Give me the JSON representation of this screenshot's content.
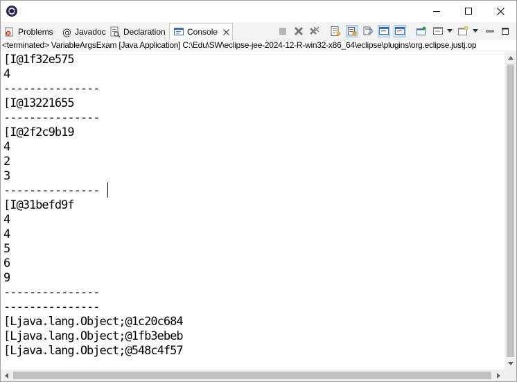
{
  "window": {
    "icon": "eclipse-icon",
    "controls": [
      "minimize-icon",
      "maximize-icon",
      "close-icon"
    ]
  },
  "tabs": [
    {
      "label": "Problems",
      "icon": "problems-icon"
    },
    {
      "label": "Javadoc",
      "icon": "javadoc-at-icon"
    },
    {
      "label": "Declaration",
      "icon": "declaration-icon"
    },
    {
      "label": "Console",
      "icon": "console-icon",
      "active": true
    }
  ],
  "toolbar": {
    "icons": [
      "terminate-icon",
      "remove-launch-icon",
      "remove-all-terminated-icon",
      "clear-console-icon",
      "scroll-lock-icon",
      "word-wrap-icon",
      "show-on-stdout-icon",
      "show-on-stderr-icon",
      "pin-console-icon",
      "display-selected-console-icon",
      "open-console-icon",
      "minimize-view-icon",
      "maximize-view-icon"
    ]
  },
  "status": {
    "text": "<terminated> VariableArgsExam [Java Application] C:\\Edu\\SW\\eclipse-jee-2024-12-R-win32-x86_64\\eclipse\\plugins\\org.eclipse.justj.op"
  },
  "console": {
    "lines": [
      "[I@1f32e575",
      "4",
      "---------------",
      "[I@13221655",
      "---------------",
      "[I@2f2c9b19",
      "4",
      "2",
      "3",
      "---------------",
      "[I@31befd9f",
      "4",
      "4",
      "5",
      "6",
      "9",
      "---------------",
      "---------------",
      "[Ljava.lang.Object;@1c20c684",
      "[Ljava.lang.Object;@1fb3ebeb",
      "[Ljava.lang.Object;@548c4f57"
    ]
  },
  "colors": {
    "accent": "#3c6eb4",
    "terminate_red": "#d63b3b",
    "text": "#000000"
  }
}
